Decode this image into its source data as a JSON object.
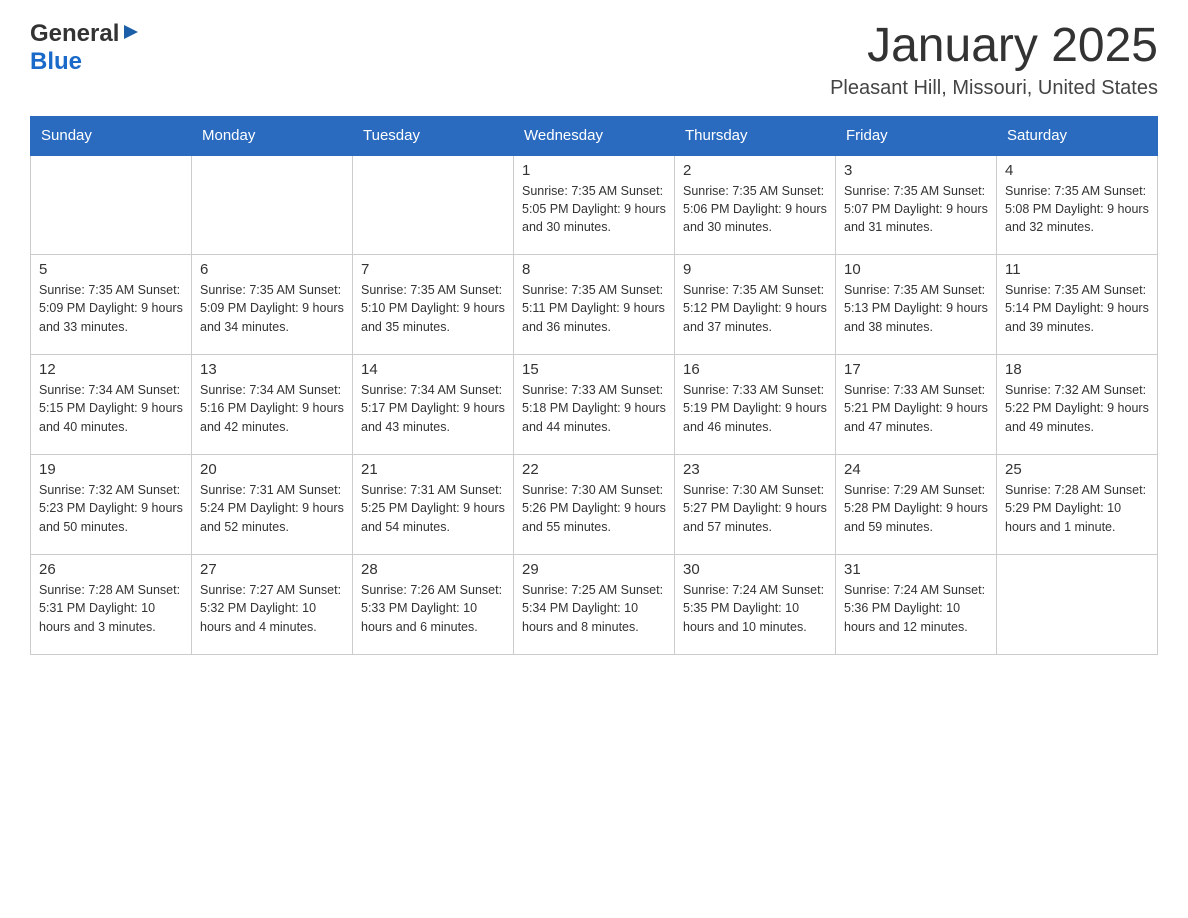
{
  "header": {
    "logo_general": "General",
    "logo_blue": "Blue",
    "title": "January 2025",
    "location": "Pleasant Hill, Missouri, United States"
  },
  "days_of_week": [
    "Sunday",
    "Monday",
    "Tuesday",
    "Wednesday",
    "Thursday",
    "Friday",
    "Saturday"
  ],
  "weeks": [
    [
      {
        "day": "",
        "info": ""
      },
      {
        "day": "",
        "info": ""
      },
      {
        "day": "",
        "info": ""
      },
      {
        "day": "1",
        "info": "Sunrise: 7:35 AM\nSunset: 5:05 PM\nDaylight: 9 hours\nand 30 minutes."
      },
      {
        "day": "2",
        "info": "Sunrise: 7:35 AM\nSunset: 5:06 PM\nDaylight: 9 hours\nand 30 minutes."
      },
      {
        "day": "3",
        "info": "Sunrise: 7:35 AM\nSunset: 5:07 PM\nDaylight: 9 hours\nand 31 minutes."
      },
      {
        "day": "4",
        "info": "Sunrise: 7:35 AM\nSunset: 5:08 PM\nDaylight: 9 hours\nand 32 minutes."
      }
    ],
    [
      {
        "day": "5",
        "info": "Sunrise: 7:35 AM\nSunset: 5:09 PM\nDaylight: 9 hours\nand 33 minutes."
      },
      {
        "day": "6",
        "info": "Sunrise: 7:35 AM\nSunset: 5:09 PM\nDaylight: 9 hours\nand 34 minutes."
      },
      {
        "day": "7",
        "info": "Sunrise: 7:35 AM\nSunset: 5:10 PM\nDaylight: 9 hours\nand 35 minutes."
      },
      {
        "day": "8",
        "info": "Sunrise: 7:35 AM\nSunset: 5:11 PM\nDaylight: 9 hours\nand 36 minutes."
      },
      {
        "day": "9",
        "info": "Sunrise: 7:35 AM\nSunset: 5:12 PM\nDaylight: 9 hours\nand 37 minutes."
      },
      {
        "day": "10",
        "info": "Sunrise: 7:35 AM\nSunset: 5:13 PM\nDaylight: 9 hours\nand 38 minutes."
      },
      {
        "day": "11",
        "info": "Sunrise: 7:35 AM\nSunset: 5:14 PM\nDaylight: 9 hours\nand 39 minutes."
      }
    ],
    [
      {
        "day": "12",
        "info": "Sunrise: 7:34 AM\nSunset: 5:15 PM\nDaylight: 9 hours\nand 40 minutes."
      },
      {
        "day": "13",
        "info": "Sunrise: 7:34 AM\nSunset: 5:16 PM\nDaylight: 9 hours\nand 42 minutes."
      },
      {
        "day": "14",
        "info": "Sunrise: 7:34 AM\nSunset: 5:17 PM\nDaylight: 9 hours\nand 43 minutes."
      },
      {
        "day": "15",
        "info": "Sunrise: 7:33 AM\nSunset: 5:18 PM\nDaylight: 9 hours\nand 44 minutes."
      },
      {
        "day": "16",
        "info": "Sunrise: 7:33 AM\nSunset: 5:19 PM\nDaylight: 9 hours\nand 46 minutes."
      },
      {
        "day": "17",
        "info": "Sunrise: 7:33 AM\nSunset: 5:21 PM\nDaylight: 9 hours\nand 47 minutes."
      },
      {
        "day": "18",
        "info": "Sunrise: 7:32 AM\nSunset: 5:22 PM\nDaylight: 9 hours\nand 49 minutes."
      }
    ],
    [
      {
        "day": "19",
        "info": "Sunrise: 7:32 AM\nSunset: 5:23 PM\nDaylight: 9 hours\nand 50 minutes."
      },
      {
        "day": "20",
        "info": "Sunrise: 7:31 AM\nSunset: 5:24 PM\nDaylight: 9 hours\nand 52 minutes."
      },
      {
        "day": "21",
        "info": "Sunrise: 7:31 AM\nSunset: 5:25 PM\nDaylight: 9 hours\nand 54 minutes."
      },
      {
        "day": "22",
        "info": "Sunrise: 7:30 AM\nSunset: 5:26 PM\nDaylight: 9 hours\nand 55 minutes."
      },
      {
        "day": "23",
        "info": "Sunrise: 7:30 AM\nSunset: 5:27 PM\nDaylight: 9 hours\nand 57 minutes."
      },
      {
        "day": "24",
        "info": "Sunrise: 7:29 AM\nSunset: 5:28 PM\nDaylight: 9 hours\nand 59 minutes."
      },
      {
        "day": "25",
        "info": "Sunrise: 7:28 AM\nSunset: 5:29 PM\nDaylight: 10 hours\nand 1 minute."
      }
    ],
    [
      {
        "day": "26",
        "info": "Sunrise: 7:28 AM\nSunset: 5:31 PM\nDaylight: 10 hours\nand 3 minutes."
      },
      {
        "day": "27",
        "info": "Sunrise: 7:27 AM\nSunset: 5:32 PM\nDaylight: 10 hours\nand 4 minutes."
      },
      {
        "day": "28",
        "info": "Sunrise: 7:26 AM\nSunset: 5:33 PM\nDaylight: 10 hours\nand 6 minutes."
      },
      {
        "day": "29",
        "info": "Sunrise: 7:25 AM\nSunset: 5:34 PM\nDaylight: 10 hours\nand 8 minutes."
      },
      {
        "day": "30",
        "info": "Sunrise: 7:24 AM\nSunset: 5:35 PM\nDaylight: 10 hours\nand 10 minutes."
      },
      {
        "day": "31",
        "info": "Sunrise: 7:24 AM\nSunset: 5:36 PM\nDaylight: 10 hours\nand 12 minutes."
      },
      {
        "day": "",
        "info": ""
      }
    ]
  ],
  "colors": {
    "header_bg": "#2a6bbf",
    "header_text": "#ffffff",
    "border": "#cccccc",
    "text": "#333333",
    "blue_accent": "#1a6ac9"
  }
}
